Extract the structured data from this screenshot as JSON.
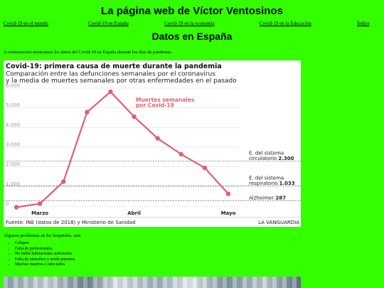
{
  "site": {
    "title": "La página web de Víctor Ventosinos"
  },
  "nav": {
    "items": [
      {
        "label": "Covid-19 en el mundo"
      },
      {
        "label": "Covid-19 en España"
      },
      {
        "label": "Covid-19 en la economía"
      },
      {
        "label": "Covid-19 en la Educación"
      },
      {
        "label": "Índice"
      }
    ]
  },
  "main": {
    "heading": "Datos en España",
    "intro": "A continuación mostramos los datos del Covid-19 en España durante los días de pandemia.",
    "problems_intro": "Algunos problemas en los hospitales, son:",
    "problems": [
      "Colapso",
      "Falta de profesionales",
      "No había habitaciones suficientes",
      "Falta de utensilios y medicamentos",
      "Muchos muertos e infectados"
    ]
  },
  "colors": {
    "background": "#33ff00",
    "series": "#e06070",
    "reference": "#333333"
  },
  "chart_data": {
    "type": "line",
    "title": "Covid-19: primera causa de muerte durante la pandemia",
    "subtitle_line1": "Comparación entre las defunciones semanales por el coronavirus",
    "subtitle_line2": "y la media de muertes semanales por otras enfermedades en el pasado",
    "x_tick_labels": [
      "Marzo",
      "Abril",
      "Mayo"
    ],
    "x_tick_positions": [
      1,
      5,
      9
    ],
    "y_ticks": [
      "0",
      "1.000",
      "2.000",
      "3.000",
      "4.000",
      "5.000",
      "6.000"
    ],
    "ylim": [
      0,
      6000
    ],
    "grid": true,
    "series": [
      {
        "name": "Muertes semanales por Covid-19",
        "label_line1": "Muertes semanales",
        "label_line2": "por Covid-19",
        "x": [
          0,
          1,
          2,
          3,
          4,
          5,
          6,
          7,
          8,
          9
        ],
        "values": [
          -50,
          130,
          1250,
          4780,
          5820,
          4550,
          3450,
          2640,
          1950,
          630
        ]
      }
    ],
    "reference_lines": [
      {
        "label_line1": "E. del sistema",
        "label_line2_prefix": "circulatorio",
        "value_text": "2.300",
        "value": 2300
      },
      {
        "label_line1": "E. del sistema",
        "label_line2_prefix": "respiratorio",
        "value_text": "1.033",
        "value": 1033
      },
      {
        "label_line1": "",
        "label_line2_prefix": "Alzheimer",
        "value_text": "287",
        "value": 287
      }
    ],
    "source": "Fuente: INE (datos de 2018) y Ministerio de Sanidad",
    "publisher": "LA VANGUARDIA"
  }
}
